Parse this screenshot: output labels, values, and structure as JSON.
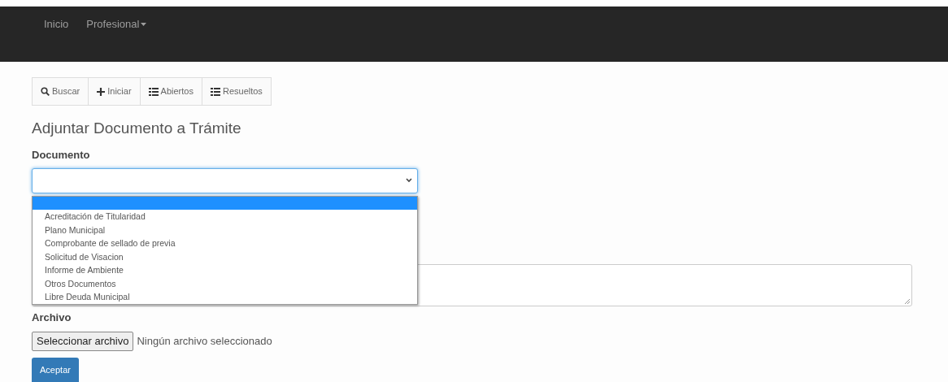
{
  "navbar": {
    "items": [
      {
        "label": "Inicio",
        "kind": "link"
      },
      {
        "label": "Profesional",
        "kind": "dropdown"
      }
    ]
  },
  "toolbar": [
    {
      "label": "Buscar",
      "kind": "search"
    },
    {
      "label": "Iniciar",
      "kind": "create"
    },
    {
      "label": "Abiertos",
      "kind": "listing"
    },
    {
      "label": "Resueltos",
      "kind": "listing"
    }
  ],
  "title": "Adjuntar Documento a Trámite",
  "documento": {
    "label": "Documento",
    "expanded": true,
    "dropdown": {
      "blank_option": {
        "selected": true
      },
      "options": [
        {
          "label": "Acreditación de Titularidad",
          "selected": false
        },
        {
          "label": "Plano Municipal",
          "selected": false
        },
        {
          "label": "Comprobante de sellado de previa",
          "selected": false
        },
        {
          "label": "Solicitud de Visacion",
          "selected": false
        },
        {
          "label": "Informe de Ambiente",
          "selected": false
        },
        {
          "label": "Otros Documentos",
          "selected": false
        },
        {
          "label": "Libre Deuda Municipal",
          "selected": false
        }
      ]
    }
  },
  "archivo": {
    "label": "Archivo",
    "button": "Seleccionar archivo",
    "status": "Ningún archivo seleccionado"
  },
  "submit": "Aceptar"
}
